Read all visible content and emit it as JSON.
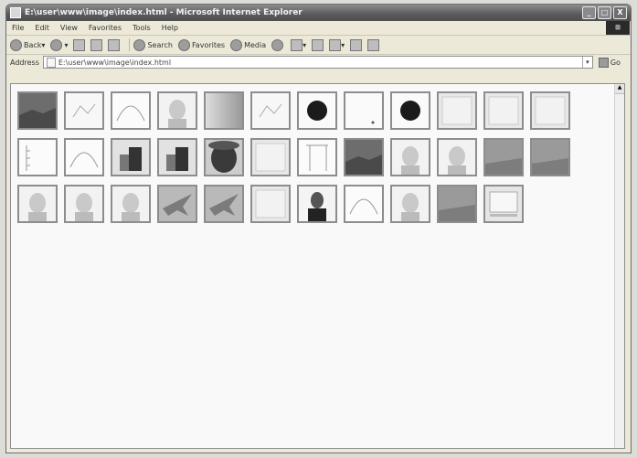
{
  "window": {
    "title": "E:\\user\\www\\image\\index.html - Microsoft Internet Explorer",
    "controls": [
      "_",
      "□",
      "X"
    ]
  },
  "menu": [
    "File",
    "Edit",
    "View",
    "Favorites",
    "Tools",
    "Help"
  ],
  "toolbar": {
    "back": "Back",
    "search": "Search",
    "favorites": "Favorites",
    "media": "Media"
  },
  "address": {
    "label": "Address",
    "value": "E:\\user\\www\\image\\index.html",
    "go": "Go"
  },
  "thumbnails": [
    {
      "kind": "photo-dark"
    },
    {
      "kind": "sketch"
    },
    {
      "kind": "curve"
    },
    {
      "kind": "face"
    },
    {
      "kind": "gradient"
    },
    {
      "kind": "sketch"
    },
    {
      "kind": "dot"
    },
    {
      "kind": "blank-dot"
    },
    {
      "kind": "dot"
    },
    {
      "kind": "light"
    },
    {
      "kind": "light"
    },
    {
      "kind": "light"
    },
    {
      "kind": "bars"
    },
    {
      "kind": "curve"
    },
    {
      "kind": "machine"
    },
    {
      "kind": "machine"
    },
    {
      "kind": "person-dark"
    },
    {
      "kind": "light"
    },
    {
      "kind": "lines"
    },
    {
      "kind": "photo-dark"
    },
    {
      "kind": "face"
    },
    {
      "kind": "face"
    },
    {
      "kind": "photo-mid"
    },
    {
      "kind": "photo-mid"
    },
    {
      "kind": "face"
    },
    {
      "kind": "face"
    },
    {
      "kind": "face"
    },
    {
      "kind": "plane"
    },
    {
      "kind": "plane"
    },
    {
      "kind": "light"
    },
    {
      "kind": "portrait"
    },
    {
      "kind": "curve"
    },
    {
      "kind": "face"
    },
    {
      "kind": "photo-mid"
    },
    {
      "kind": "screen"
    }
  ]
}
